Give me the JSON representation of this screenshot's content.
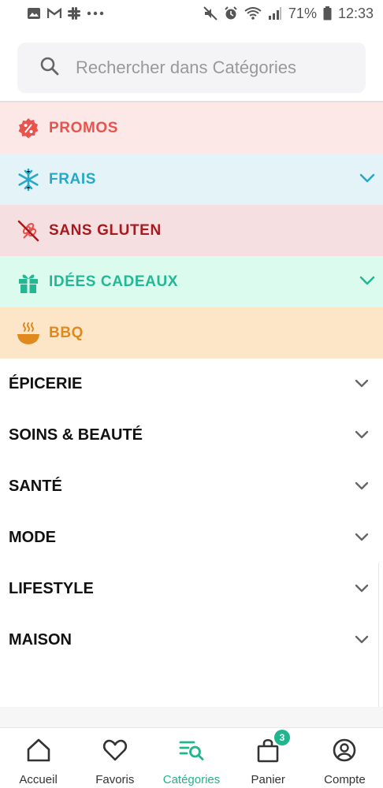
{
  "status_bar": {
    "left_icons": [
      "image-icon",
      "gmail-icon",
      "slack-icon",
      "more-dots-icon"
    ],
    "right_icons": [
      "mute-icon",
      "alarm-icon",
      "wifi-icon",
      "signal-icon"
    ],
    "battery": "71%",
    "time": "12:33"
  },
  "search": {
    "placeholder": "Rechercher dans Catégories"
  },
  "highlights": [
    {
      "label": "PROMOS",
      "icon": "percent-badge-icon",
      "text_color": "#e8534e",
      "bg": "#fde8e8",
      "expandable": false
    },
    {
      "label": "FRAIS",
      "icon": "snowflake-icon",
      "text_color": "#27a9c6",
      "bg": "#e3f3f8",
      "expandable": true
    },
    {
      "label": "SANS GLUTEN",
      "icon": "no-gluten-icon",
      "text_color": "#a81a1f",
      "bg": "#f5dfe0",
      "expandable": false
    },
    {
      "label": "IDÉES CADEAUX",
      "icon": "gift-icon",
      "text_color": "#23b893",
      "bg": "#dcfbef",
      "expandable": true
    },
    {
      "label": "BBQ",
      "icon": "bbq-bowl-icon",
      "text_color": "#e08a1e",
      "bg": "#fde5c8",
      "expandable": false
    }
  ],
  "categories": [
    {
      "label": "ÉPICERIE"
    },
    {
      "label": "SOINS & BEAUTÉ"
    },
    {
      "label": "SANTÉ"
    },
    {
      "label": "MODE"
    },
    {
      "label": "LIFESTYLE"
    },
    {
      "label": "MAISON"
    }
  ],
  "bottom_nav": {
    "active_color": "#20b58c",
    "items": [
      {
        "label": "Accueil",
        "icon": "home-icon"
      },
      {
        "label": "Favoris",
        "icon": "heart-icon"
      },
      {
        "label": "Catégories",
        "icon": "categories-search-icon",
        "active": true
      },
      {
        "label": "Panier",
        "icon": "cart-bag-icon",
        "badge": "3"
      },
      {
        "label": "Compte",
        "icon": "account-icon"
      }
    ]
  }
}
